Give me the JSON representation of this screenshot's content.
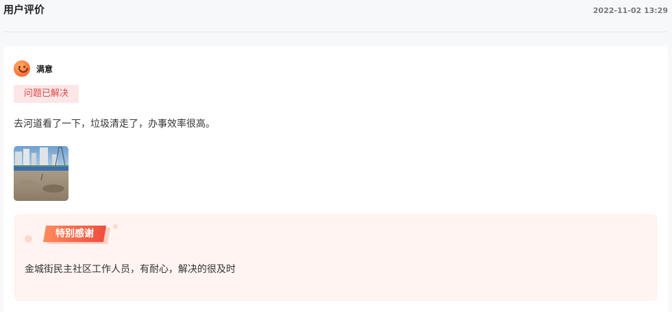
{
  "header": {
    "title": "用户评价",
    "time": "2022-11-02 13:29"
  },
  "review": {
    "rating_icon": "smile-face-icon",
    "rating_label": "满意",
    "tag": "问题已解决",
    "comment": "去河道看了一下，垃圾清走了，办事效率很高。",
    "photo": "riverside-photo"
  },
  "thanks": {
    "badge": "特别感谢",
    "text": "金城街民主社区工作人员，有耐心，解决的很及时"
  },
  "colors": {
    "accent": "#f04e3e",
    "tag_bg": "#fde6e6",
    "tag_text": "#d94a4a",
    "thanks_bg": "#fff4f1"
  }
}
